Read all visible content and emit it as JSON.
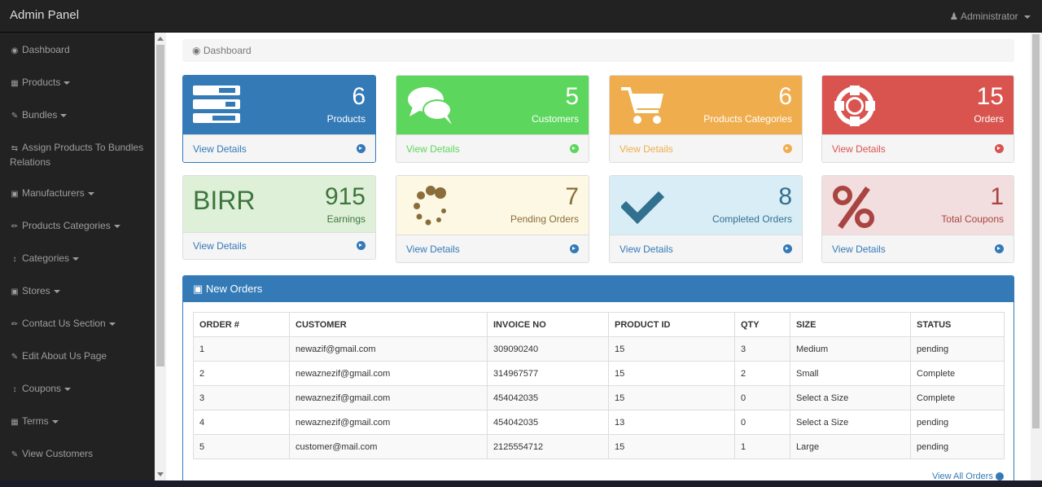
{
  "app": {
    "title": "Admin Panel",
    "user": "Administrator"
  },
  "sidebar": {
    "items": [
      {
        "label": "Dashboard",
        "icon": "dashboard-icon",
        "dropdown": false
      },
      {
        "label": "Products",
        "icon": "table-icon",
        "dropdown": true
      },
      {
        "label": "Bundles",
        "icon": "edit-icon",
        "dropdown": true
      },
      {
        "label": "Assign Products To Bundles Relations",
        "icon": "retweet-icon",
        "dropdown": false
      },
      {
        "label": "Manufacturers",
        "icon": "briefcase-icon",
        "dropdown": true
      },
      {
        "label": "Products Categories",
        "icon": "pencil-icon",
        "dropdown": true
      },
      {
        "label": "Categories",
        "icon": "sort-icon",
        "dropdown": true
      },
      {
        "label": "Stores",
        "icon": "briefcase-icon",
        "dropdown": true
      },
      {
        "label": "Contact Us Section",
        "icon": "pencil-icon",
        "dropdown": true
      },
      {
        "label": "Edit About Us Page",
        "icon": "edit-icon",
        "dropdown": false
      },
      {
        "label": "Coupons",
        "icon": "sort-icon",
        "dropdown": true
      },
      {
        "label": "Terms",
        "icon": "table-icon",
        "dropdown": true
      },
      {
        "label": "View Customers",
        "icon": "edit-icon",
        "dropdown": false
      }
    ]
  },
  "breadcrumb": {
    "label": "Dashboard"
  },
  "panels": [
    {
      "count": "6",
      "label": "Products",
      "link": "View Details",
      "color": "#337ab7",
      "icon": "tasks-icon"
    },
    {
      "count": "5",
      "label": "Customers",
      "link": "View Details",
      "color": "#5cd65c",
      "icon": "comments-icon"
    },
    {
      "count": "6",
      "label": "Products Categories",
      "link": "View Details",
      "color": "#f0ad4e",
      "icon": "shopping-cart-icon"
    },
    {
      "count": "15",
      "label": "Orders",
      "link": "View Details",
      "color": "#d9534f",
      "icon": "support-icon"
    },
    {
      "count": "915",
      "label": "Earnings",
      "link": "View Details",
      "prefix": "BIRR",
      "color": "#dff0d8",
      "icon": "birr-text"
    },
    {
      "count": "7",
      "label": "Pending Orders",
      "link": "View Details",
      "color": "#fcf8e3",
      "icon": "spinner-icon"
    },
    {
      "count": "8",
      "label": "Completed Orders",
      "link": "View Details",
      "color": "#d9edf7",
      "icon": "check-icon"
    },
    {
      "count": "1",
      "label": "Total Coupons",
      "link": "View Details",
      "color": "#f2dede",
      "icon": "percent-icon"
    }
  ],
  "orders": {
    "title": "New Orders",
    "headers": [
      "ORDER #",
      "CUSTOMER",
      "INVOICE NO",
      "PRODUCT ID",
      "QTY",
      "SIZE",
      "STATUS"
    ],
    "rows": [
      [
        "1",
        "newazif@gmail.com",
        "309090240",
        "15",
        "3",
        "Medium",
        "pending"
      ],
      [
        "2",
        "newaznezif@gmail.com",
        "314967577",
        "15",
        "2",
        "Small",
        "Complete"
      ],
      [
        "3",
        "newaznezif@gmail.com",
        "454042035",
        "15",
        "0",
        "Select a Size",
        "Complete"
      ],
      [
        "4",
        "newaznezif@gmail.com",
        "454042035",
        "13",
        "0",
        "Select a Size",
        "pending"
      ],
      [
        "5",
        "customer@mail.com",
        "2125554712",
        "15",
        "1",
        "Large",
        "pending"
      ]
    ],
    "view_all": "View All Orders"
  }
}
